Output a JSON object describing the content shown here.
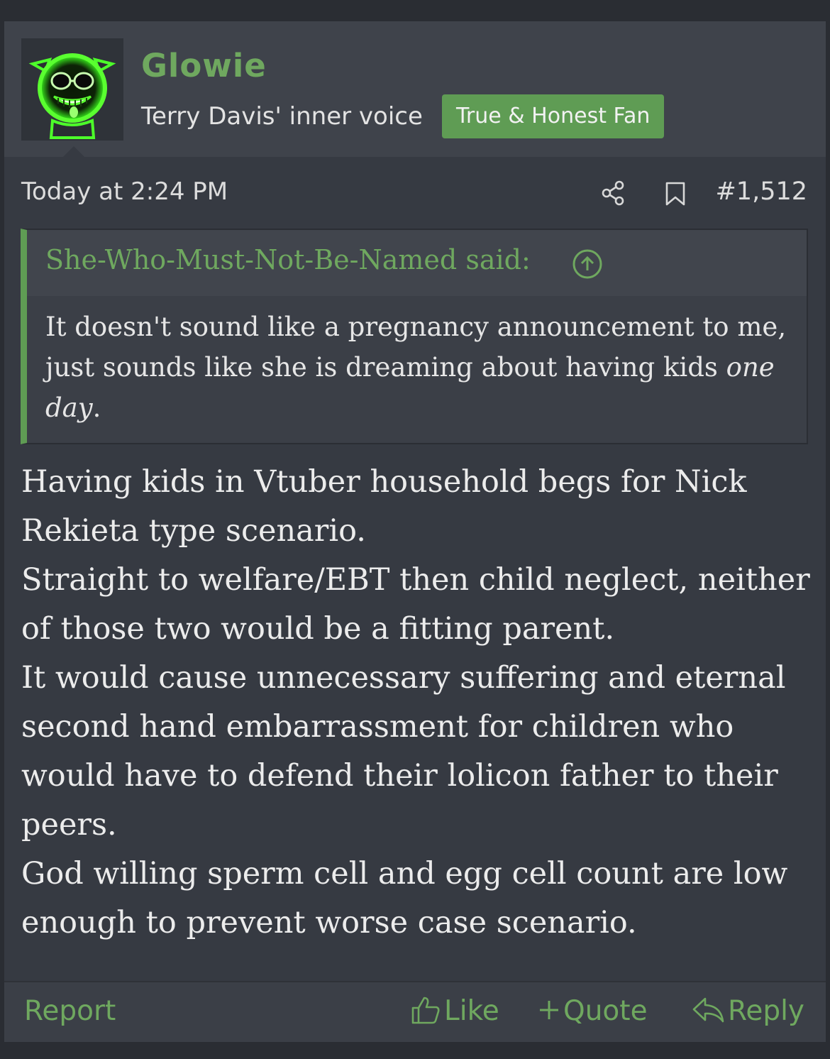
{
  "user": {
    "name": "Glowie",
    "title": "Terry Davis' inner voice",
    "banner": "True & Honest Fan",
    "avatar_icon": "glowing-green-face-avatar"
  },
  "post": {
    "date": "Today at 2:24 PM",
    "number": "#1,512",
    "share_icon": "share-icon",
    "bookmark_icon": "bookmark-icon"
  },
  "quote": {
    "attribution": "She-Who-Must-Not-Be-Named said:",
    "text_main": "It doesn't sound like a pregnancy announcement to me, just sounds like she is dreaming about having kids ",
    "text_italic": "one day",
    "text_end": "."
  },
  "message": {
    "lines": [
      "Having kids in Vtuber household begs for Nick Rekieta type scenario.",
      "Straight to welfare/EBT then child neglect, neither of those two would be a fitting parent.",
      "It would cause unnecessary suffering and eternal second hand embarrassment for children who would have to defend their lolicon father to their peers.",
      "God willing sperm cell and egg cell count are low enough to prevent worse case scenario."
    ]
  },
  "footer": {
    "report": "Report",
    "like": "Like",
    "quote": "Quote",
    "reply": "Reply"
  },
  "colors": {
    "accent": "#6fa85f",
    "banner_bg": "#5f9c54",
    "post_bg": "#363a42",
    "header_bg": "#3f434b"
  }
}
